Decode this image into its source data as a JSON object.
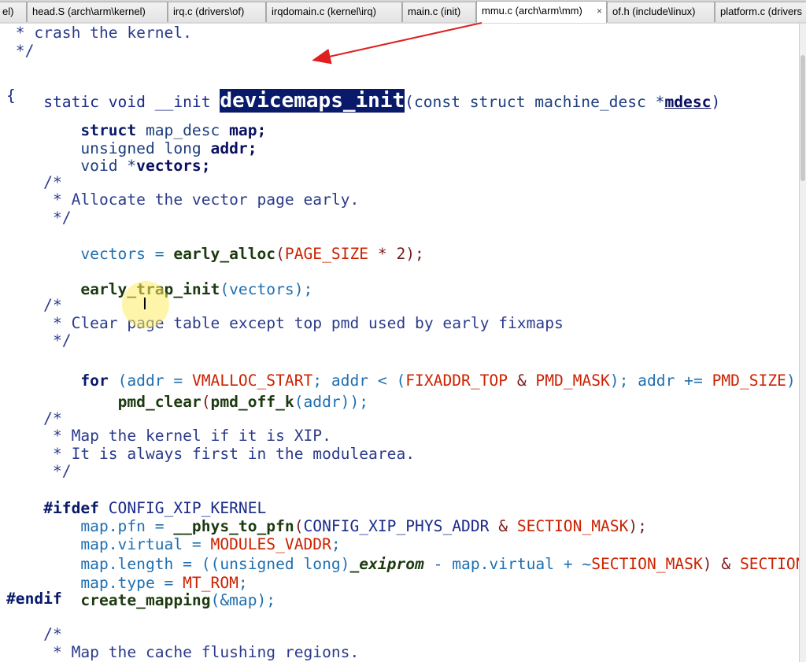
{
  "tabs": [
    {
      "label": "el)",
      "active": false
    },
    {
      "label": "head.S (arch\\arm\\kernel)",
      "active": false
    },
    {
      "label": "irq.c (drivers\\of)",
      "active": false
    },
    {
      "label": "irqdomain.c (kernel\\irq)",
      "active": false
    },
    {
      "label": "main.c (init)",
      "active": false
    },
    {
      "label": "mmu.c (arch\\arm\\mm)",
      "active": true,
      "close": "×"
    },
    {
      "label": "of.h (include\\linux)",
      "active": false
    },
    {
      "label": "platform.c (drivers",
      "active": false
    }
  ],
  "code": {
    "l01": " * crash the kernel.",
    "l02": " */",
    "l03_static": "static void __init ",
    "l03_fn": "devicemaps_init",
    "l03_paren": "(",
    "l03_const": "const struct machine_desc *",
    "l03_arg": "mdesc",
    "l03_close": ")",
    "l04": "{",
    "l05_a": "    struct ",
    "l05_b": "map_desc ",
    "l05_c": "map;",
    "l06_a": "    unsigned long ",
    "l06_b": "addr;",
    "l07_a": "    void *",
    "l07_b": "vectors;",
    "l09": "    /*",
    "l10": "     * Allocate the vector page early.",
    "l11": "     */",
    "l12_a": "    vectors = ",
    "l12_b": "early_alloc",
    "l12_c": "(",
    "l12_d": "PAGE_SIZE",
    "l12_e": " * 2);",
    "l14_a": "    ",
    "l14_b": "early_trap_init",
    "l14_c": "(vectors);",
    "l16": "    /*",
    "l17": "     * Clear page table except top pmd used by early fixmaps",
    "l18": "     */",
    "l19_a": "    for ",
    "l19_b": "(addr = ",
    "l19_c": "VMALLOC_START",
    "l19_d": "; addr < (",
    "l19_e": "FIXADDR_TOP",
    "l19_f": " & ",
    "l19_g": "PMD_MASK",
    "l19_h": "); addr += ",
    "l19_i": "PMD_SIZE",
    "l19_j": ")",
    "l20_a": "        ",
    "l20_b": "pmd_clear",
    "l20_c": "(",
    "l20_d": "pmd_off_k",
    "l20_e": "(addr));",
    "l22": "    /*",
    "l23": "     * Map the kernel if it is XIP.",
    "l24": "     * It is always first in the modulearea.",
    "l25": "     */",
    "l26_a": "#ifdef ",
    "l26_b": "CONFIG_XIP_KERNEL",
    "l27_a": "    map.pfn = ",
    "l27_b": "__phys_to_pfn",
    "l27_c": "(",
    "l27_d": "CONFIG_XIP_PHYS_ADDR",
    "l27_e": " & ",
    "l27_f": "SECTION_MASK",
    "l27_g": ");",
    "l28_a": "    map.virtual = ",
    "l28_b": "MODULES_VADDR",
    "l28_c": ";",
    "l29_a": "    map.length = ((unsigned long)",
    "l29_b": "_exiprom",
    "l29_c": " - map.virtual + ~",
    "l29_d": "SECTION_MASK",
    "l29_e": ") & ",
    "l29_f": "SECTION_MAS",
    "l30_a": "    map.type = ",
    "l30_b": "MT_ROM",
    "l30_c": ";",
    "l31_a": "    ",
    "l31_b": "create_mapping",
    "l31_c": "(&map);",
    "l32": "#endif",
    "l34": "    /*",
    "l35": "     * Map the cache flushing regions."
  },
  "cursor": {
    "glyph": "I"
  },
  "colors": {
    "highlight_bg": "#0a1a6a",
    "arrow": "#e02020",
    "macro": "#cc2200"
  }
}
